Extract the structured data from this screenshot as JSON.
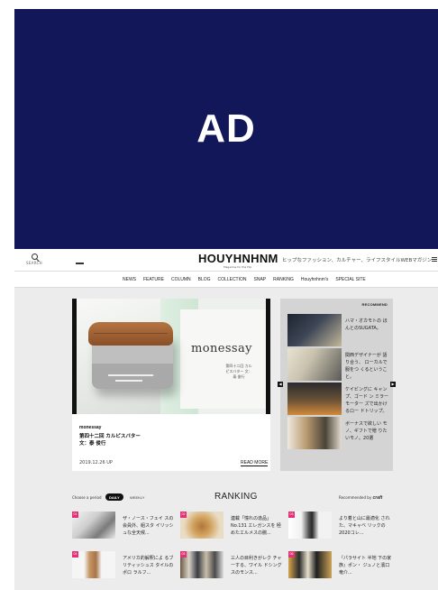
{
  "ad": {
    "label": "AD",
    "background": "#12175a"
  },
  "header": {
    "search_label": "SEARCH",
    "logo": "HOUYHNHNM",
    "logo_sub": "Magazine for the Hip",
    "tagline": "ヒップなファッション、カルチャー、ライフスタイルWEBマガジン"
  },
  "nav": {
    "items": [
      "NEWS",
      "FEATURE",
      "COLUMN",
      "BLOG",
      "COLLECTION",
      "SNAP",
      "RANKING",
      "Houyhnhnm's",
      "SPECIAL SITE"
    ]
  },
  "feature": {
    "image_title": "monessay",
    "image_sub": "第四十二回 カルピスバター 文：泰 俊行",
    "tag": "monessay",
    "title": "第四十二回 カルピスバター",
    "author": "文：泰 俊行",
    "date": "2019.12.26 UP",
    "read_more": "READ MORE"
  },
  "recommend": {
    "heading": "RECOMMEND",
    "items": [
      {
        "text": "ハマ・オカモトの ほんとのSUGATA。"
      },
      {
        "text": "関西デザイナーが 語り合う、 ローカルで服をつ くるということ。"
      },
      {
        "text": "ケイビングに キャンプ、ゴード ン ミラー モーター ズで出かけるロー ドトリップ。"
      },
      {
        "text": "ボーナスで欲しい モノ、ギフトで贈 りたいモノ。20選"
      }
    ]
  },
  "ranking": {
    "period_label": "Choose a period",
    "daily": "DAILY",
    "weekly": "WEEKLY",
    "title": "RANKING",
    "recommended_by": "Recommended by",
    "recommended_brand": "craft",
    "accent": "#e43077",
    "items": [
      {
        "rank": "01",
        "text": "ザ・ノース・フェイ スの会員外、組スタ イリッシュな全天候..."
      },
      {
        "rank": "02",
        "text": "連載「憧れの逸品」 No.131 エレガンスを 極めたエルメスの腕..."
      },
      {
        "rank": "03",
        "text": "より着と山に最適化 された、マキャベ リックの2020コレ..."
      },
      {
        "rank": "04",
        "text": "アメリカ的解釈によ るブリティッシュス タイルのポロ ラルフ..."
      },
      {
        "rank": "05",
        "text": "三人の目利きがレク チャーする、ワイル ドシングスのモンス..."
      },
      {
        "rank": "06",
        "text": "『パラサイト 半地 下の家族』ポン・ ジュノと濱口竜介..."
      }
    ]
  }
}
